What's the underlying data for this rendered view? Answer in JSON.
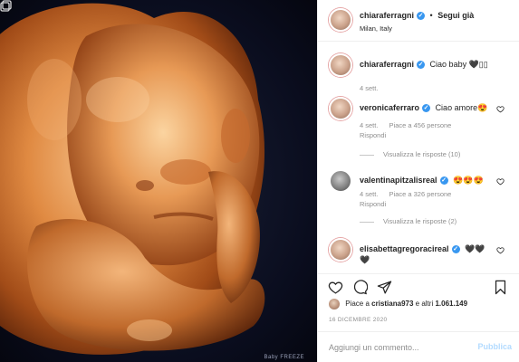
{
  "post": {
    "photo_alt": "ultrasound",
    "watermark": "Baby FREEZE"
  },
  "header": {
    "username": "chiaraferragni",
    "separator": "•",
    "follow_label": "Segui già",
    "location": "Milan, Italy"
  },
  "caption": {
    "username": "chiaraferragni",
    "text": "Ciao baby 🖤▯▯",
    "time": "4 sett."
  },
  "comments": [
    {
      "username": "veronicaferraro",
      "text": "Ciao amore😍",
      "time": "4 sett.",
      "likes": "Piace a 456 persone",
      "reply": "Rispondi",
      "thread": "Visualizza le risposte (10)"
    },
    {
      "username": "valentinapitzalisreal",
      "text": "😍😍😍",
      "time": "4 sett.",
      "likes": "Piace a 326 persone",
      "reply": "Rispondi",
      "thread": "Visualizza le risposte (2)"
    },
    {
      "username": "elisabettagregoracireal",
      "text": "🖤🖤",
      "text2": "🖤"
    }
  ],
  "liked_by": {
    "prefix": "Piace a",
    "user": "cristiana973",
    "middle": "e altri",
    "count": "1.061.149"
  },
  "date": "16 DICEMBRE 2020",
  "comment_input": {
    "placeholder": "Aggiungi un commento...",
    "publish_label": "Pubblica"
  },
  "colors": {
    "accent": "#3897f0",
    "publish_disabled": "#b3dbff"
  }
}
